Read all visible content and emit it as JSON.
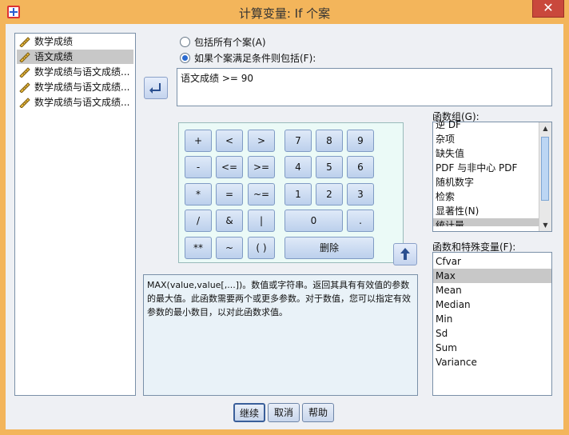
{
  "window": {
    "title": "计算变量: If 个案",
    "close_glyph": "✕"
  },
  "variables": [
    {
      "label": "数学成绩",
      "selected": false
    },
    {
      "label": "语文成绩",
      "selected": true
    },
    {
      "label": "数学成绩与语文成绩...",
      "selected": false
    },
    {
      "label": "数学成绩与语文成绩...",
      "selected": false
    },
    {
      "label": "数学成绩与语文成绩...",
      "selected": false
    }
  ],
  "options": {
    "include_all": "包括所有个案(A)",
    "include_if": "如果个案满足条件则包括(F):",
    "selected": "include_if"
  },
  "condition": {
    "value": "语文成绩 >= 90"
  },
  "keypad": {
    "keys": [
      "+",
      "<",
      ">",
      "7",
      "8",
      "9",
      "-",
      "<=",
      ">=",
      "4",
      "5",
      "6",
      "*",
      "=",
      "~=",
      "1",
      "2",
      "3",
      "/",
      "&",
      "|",
      "0",
      ".",
      "**",
      "~",
      "( )",
      "删除"
    ]
  },
  "description": "MAX(value,value[,...])。数值或字符串。返回其具有有效值的参数的最大值。此函数需要两个或更多参数。对于数值，您可以指定有效参数的最小数目，以对此函数求值。",
  "function_group": {
    "label": "函数组(G):",
    "items": [
      "逆 DF",
      "杂项",
      "缺失值",
      "PDF 与非中心 PDF",
      "随机数字",
      "检索",
      "显著性(N)",
      "统计量"
    ],
    "selected_index": 7
  },
  "functions": {
    "label": "函数和特殊变量(F):",
    "items": [
      "Cfvar",
      "Max",
      "Mean",
      "Median",
      "Min",
      "Sd",
      "Sum",
      "Variance"
    ],
    "selected_index": 1
  },
  "buttons": {
    "continue": "继续",
    "cancel": "取消",
    "help": "帮助"
  },
  "colors": {
    "titlebar": "#f3b55b",
    "close": "#c9483c",
    "selection": "#c8c8c8",
    "keypad_bg": "#ebfaf7"
  }
}
